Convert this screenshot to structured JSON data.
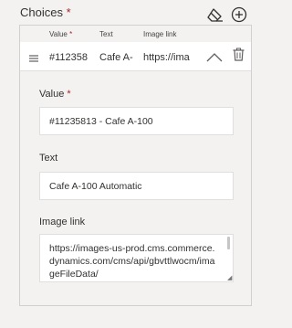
{
  "header": {
    "title": "Choices",
    "required_mark": "*",
    "icons": [
      "eraser-icon",
      "add-circle-icon"
    ]
  },
  "columns": {
    "value": "Value",
    "value_required": "*",
    "text": "Text",
    "image_link": "Image link"
  },
  "row": {
    "value": "#112358",
    "text": "Cafe A-",
    "image_link": "https://ima",
    "icons": [
      "drag-handle-icon",
      "chevron-up-icon",
      "trash-icon"
    ]
  },
  "form": {
    "value_label": "Value",
    "value_required": "*",
    "value_field": "#11235813 - Cafe A-100",
    "text_label": "Text",
    "text_field": "Cafe A-100 Automatic",
    "image_label": "Image link",
    "image_field": "https://images-us-prod.cms.commerce.dynamics.com/cms/api/gbvttlwocm/imageFileData/"
  }
}
